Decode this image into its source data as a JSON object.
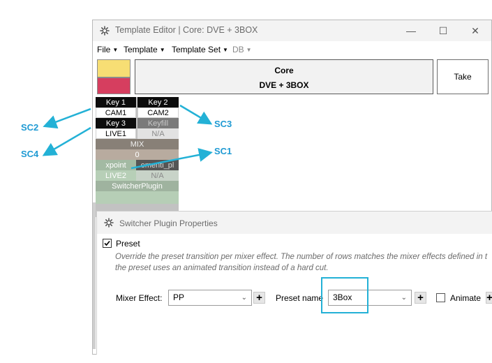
{
  "window": {
    "title": "Template Editor | Core: DVE + 3BOX",
    "icon": "gear-sparkle-icon",
    "controls": [
      "minimize-icon",
      "maximize-icon",
      "close-icon"
    ]
  },
  "menubar": {
    "items": [
      {
        "label": "File",
        "enabled": true
      },
      {
        "label": "Template",
        "enabled": true
      },
      {
        "label": "Template Set",
        "enabled": true
      },
      {
        "label": "DB",
        "enabled": false
      }
    ]
  },
  "swatches": [
    "#f7de74",
    "#d63e5f"
  ],
  "core": {
    "line1": "Core",
    "line2": "DVE + 3BOX"
  },
  "take_label": "Take",
  "panel": {
    "key1": "Key 1",
    "key2": "Key 2",
    "cam1": "CAM1",
    "cam2": "CAM2",
    "key3": "Key 3",
    "keyfill": "Keyfill",
    "live1": "LIVE1",
    "na1": "N/A",
    "mix": "MIX",
    "zero": "0",
    "xpoint": "xpoint",
    "element": "ementi_pl",
    "live2": "LIVE2",
    "na2": "N/A",
    "plugin": "SwitcherPlugin"
  },
  "callouts": {
    "sc1": "SC1",
    "sc2": "SC2",
    "sc3": "SC3",
    "sc4": "SC4"
  },
  "dialog": {
    "title": "Switcher Plugin Properties",
    "preset_label": "Preset",
    "preset_checked": true,
    "desc_line1": "Override the preset transition per mixer effect. The number of rows matches the mixer effects defined in t",
    "desc_line2": "the preset uses an animated transition instead of a hard cut.",
    "mixer_label": "Mixer Effect:",
    "mixer_value": "PP",
    "preset_name_label": "Preset name",
    "preset_name_value": "3Box",
    "animate_label": "Animate",
    "animate_checked": false
  },
  "colors": {
    "accent": "#1f9ad3",
    "highlight": "#23b1d6"
  }
}
